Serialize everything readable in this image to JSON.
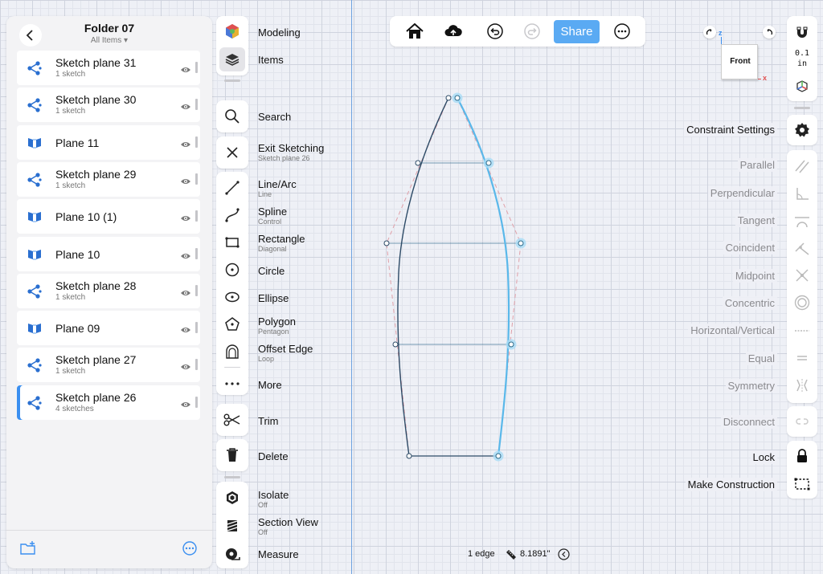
{
  "browser": {
    "title": "Folder 07",
    "subtitle": "All Items ▾",
    "items": [
      {
        "title": "Sketch plane 31",
        "sub": "1 sketch",
        "kind": "sketch"
      },
      {
        "title": "Sketch plane 30",
        "sub": "1 sketch",
        "kind": "sketch"
      },
      {
        "title": "Plane 11",
        "sub": "",
        "kind": "plane"
      },
      {
        "title": "Sketch plane 29",
        "sub": "1 sketch",
        "kind": "sketch"
      },
      {
        "title": "Plane 10 (1)",
        "sub": "",
        "kind": "plane"
      },
      {
        "title": "Plane 10",
        "sub": "",
        "kind": "plane"
      },
      {
        "title": "Sketch plane 28",
        "sub": "1 sketch",
        "kind": "sketch"
      },
      {
        "title": "Plane 09",
        "sub": "",
        "kind": "plane"
      },
      {
        "title": "Sketch plane 27",
        "sub": "1 sketch",
        "kind": "sketch"
      },
      {
        "title": "Sketch plane 26",
        "sub": "4 sketches",
        "kind": "sketch",
        "active": true
      }
    ]
  },
  "tools": {
    "modeling": "Modeling",
    "items": "Items",
    "search": "Search",
    "exit_sketching": "Exit Sketching",
    "exit_sketching_sub": "Sketch plane 26",
    "line_arc": "Line/Arc",
    "line_arc_sub": "Line",
    "spline": "Spline",
    "spline_sub": "Control",
    "rectangle": "Rectangle",
    "rectangle_sub": "Diagonal",
    "circle": "Circle",
    "ellipse": "Ellipse",
    "polygon": "Polygon",
    "polygon_sub": "Pentagon",
    "offset_edge": "Offset Edge",
    "offset_edge_sub": "Loop",
    "more": "More",
    "trim": "Trim",
    "delete": "Delete",
    "isolate": "Isolate",
    "isolate_sub": "Off",
    "section_view": "Section View",
    "section_view_sub": "Off",
    "measure": "Measure"
  },
  "toolbar": {
    "share": "Share"
  },
  "view_cube": {
    "face": "Front",
    "axis_x": "x",
    "axis_z": "z"
  },
  "units": {
    "value": "0.1",
    "unit": "in"
  },
  "constraints": {
    "settings": "Constraint Settings",
    "parallel": "Parallel",
    "perpendicular": "Perpendicular",
    "tangent": "Tangent",
    "coincident": "Coincident",
    "midpoint": "Midpoint",
    "concentric": "Concentric",
    "horizontal_vertical": "Horizontal/Vertical",
    "equal": "Equal",
    "symmetry": "Symmetry",
    "disconnect": "Disconnect",
    "lock": "Lock",
    "make_construction": "Make Construction"
  },
  "status": {
    "selection": "1 edge",
    "measure": "8.1891\""
  },
  "colors": {
    "accent": "#5aaaf3",
    "selected_edge": "#5ab8ea",
    "sketch_edge": "#2c4a66",
    "construction": "#e0a0a8"
  }
}
